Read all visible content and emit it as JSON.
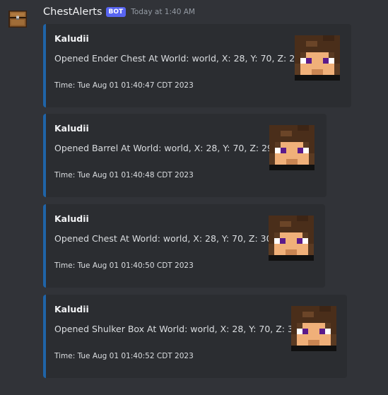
{
  "message": {
    "author": "ChestAlerts",
    "badge": "BOT",
    "timestamp": "Today at 1:40 AM",
    "avatar_icon": "chest-icon"
  },
  "accent_color": "#1f64a8",
  "embeds": [
    {
      "author": "Kaludii",
      "description": "Opened Ender Chest At World: world, X: 28, Y: 70, Z: 28",
      "footer": "Time: Tue Aug 01 01:40:47 CDT 2023",
      "thumbnail_icon": "player-head-icon"
    },
    {
      "author": "Kaludii",
      "description": "Opened Barrel At World: world, X: 28, Y: 70, Z: 29",
      "footer": "Time: Tue Aug 01 01:40:48 CDT 2023",
      "thumbnail_icon": "player-head-icon"
    },
    {
      "author": "Kaludii",
      "description": "Opened Chest At World: world, X: 28, Y: 70, Z: 30",
      "footer": "Time: Tue Aug 01 01:40:50 CDT 2023",
      "thumbnail_icon": "player-head-icon"
    },
    {
      "author": "Kaludii",
      "description": "Opened Shulker Box At World: world, X: 28, Y: 70, Z: 31",
      "footer": "Time: Tue Aug 01 01:40:52 CDT 2023",
      "thumbnail_icon": "player-head-icon"
    }
  ]
}
